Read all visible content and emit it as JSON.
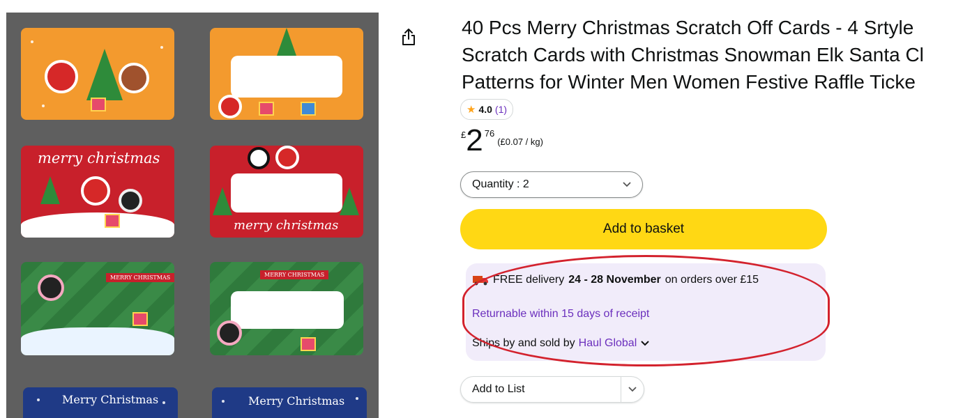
{
  "product": {
    "title_lines": [
      "40 Pcs Merry Christmas Scratch Off Cards - 4 Srtyle",
      "Scratch Cards with Christmas Snowman Elk Santa Cl",
      "Patterns for Winter Men Women Festive Raffle Ticke"
    ],
    "rating": {
      "score": "4.0",
      "count": "(1)",
      "stars": 4.0
    },
    "price": {
      "currency": "£",
      "whole": "2",
      "fraction": "76",
      "unit_price": "(£0.07 / kg)"
    }
  },
  "gallery": {
    "labels": {
      "merry_christmas_script_1": "merry christmas",
      "merry_christmas_script_2": "merry christmas",
      "merry_small_1": "MERRY CHRISTMAS",
      "merry_small_2": "MERRY CHRISTMAS",
      "merry_blue_1": "Merry Christmas",
      "merry_blue_2": "Merry Christmas"
    },
    "colors": {
      "background": "#5f5f5f",
      "orange": "#f39a2e",
      "red": "#c8202b",
      "green": "#2f7a3c",
      "blue": "#1f3a86"
    }
  },
  "buy_box": {
    "quantity_label": "Quantity : 2",
    "add_to_basket": "Add to basket",
    "delivery": {
      "prefix": "FREE delivery",
      "dates": "24 - 28 November",
      "suffix": "on orders over £15"
    },
    "returnable": "Returnable within 15 days of receipt",
    "ships": {
      "prefix": "Ships by and sold by",
      "seller": "Haul Global"
    },
    "add_to_list": "Add to List"
  },
  "icons": {
    "share": "share-icon",
    "star": "star-icon",
    "truck": "truck-icon",
    "chevron": "chevron-down-icon"
  },
  "colors": {
    "accent_button": "#ffd814",
    "link": "#6b2fbd",
    "highlight_box": "#f1ecfa",
    "annotation_oval": "#d3222d",
    "star": "#ffa41c"
  }
}
